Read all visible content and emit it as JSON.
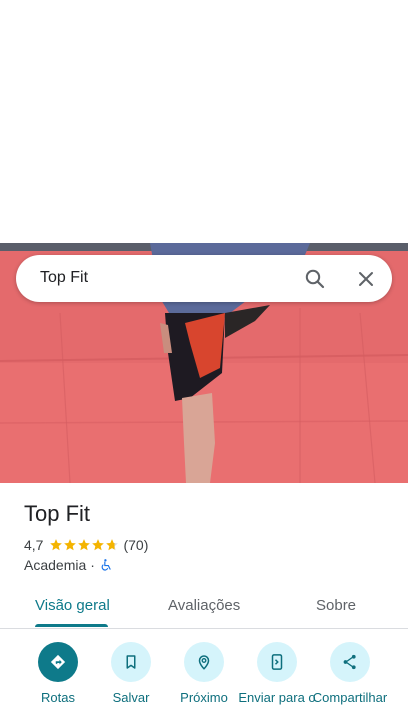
{
  "search": {
    "query": "Top Fit"
  },
  "place": {
    "name": "Top Fit",
    "rating": "4,7",
    "stars": 4.7,
    "review_count": "(70)",
    "category": "Academia",
    "separator": "·"
  },
  "tabs": [
    {
      "label": "Visão geral",
      "active": true
    },
    {
      "label": "Avaliações",
      "active": false
    },
    {
      "label": "Sobre",
      "active": false
    }
  ],
  "actions": [
    {
      "label": "Rotas",
      "icon": "directions-icon"
    },
    {
      "label": "Salvar",
      "icon": "bookmark-icon"
    },
    {
      "label": "Próximo",
      "icon": "nearby-icon"
    },
    {
      "label": "Enviar para o",
      "icon": "send-to-phone-icon"
    },
    {
      "label": "Compartilhar",
      "icon": "share-icon"
    }
  ],
  "colors": {
    "accent": "#0e7a8a",
    "action_bg": "#d5f4fb",
    "star": "#f4b400",
    "accessibility": "#1a73e8"
  }
}
